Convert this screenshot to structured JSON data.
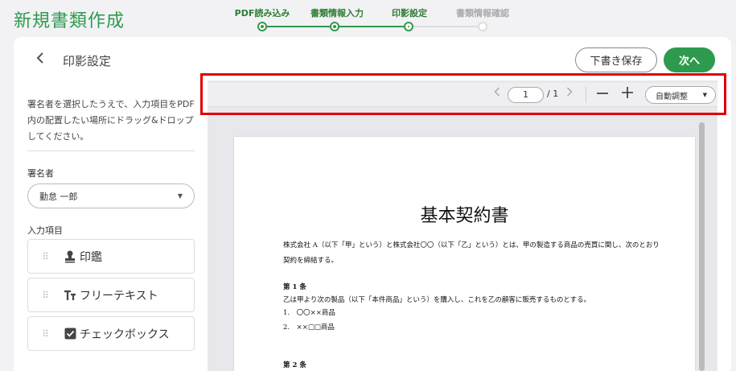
{
  "app": {
    "title": "新規書類作成"
  },
  "stepper": {
    "steps": [
      {
        "label": "PDF読み込み",
        "state": "done"
      },
      {
        "label": "書類情報入力",
        "state": "done"
      },
      {
        "label": "印影設定",
        "state": "current"
      },
      {
        "label": "書類情報確認",
        "state": "inactive"
      }
    ]
  },
  "header": {
    "back_icon": "chevron-left-icon",
    "title": "印影設定",
    "draft_label": "下書き保存",
    "next_label": "次へ"
  },
  "sidebar": {
    "instructions": "署名者を選択したうえで、入力項目をPDF内の配置したい場所にドラッグ&ドロップしてください。",
    "signer_label": "署名者",
    "signer_value": "勤怠 一郎",
    "items_label": "入力項目",
    "items": [
      {
        "icon": "stamp-icon",
        "label": "印鑑"
      },
      {
        "icon": "text-icon",
        "label": "フリーテキスト"
      },
      {
        "icon": "checkbox-icon",
        "label": "チェックボックス"
      }
    ]
  },
  "toolbar": {
    "page_current": "1",
    "page_total": "/ 1",
    "zoom_label": "自動調整"
  },
  "document": {
    "title": "基本契約書",
    "lines": [
      "株式会社 A（以下「甲」という）と株式会社〇〇（以下「乙」という）とは、甲の製造する商品の売買に関し、次のとおり",
      "契約を締結する。",
      "第 1 条",
      "乙は甲より次の製品（以下「本件商品」という）を購入し、これを乙の顧客に販売するものとする。",
      "1.　〇〇××商品",
      "2.　××□□商品",
      "第 2 条"
    ]
  },
  "colors": {
    "accent": "#2e9a4e",
    "highlight": "#e00000"
  }
}
